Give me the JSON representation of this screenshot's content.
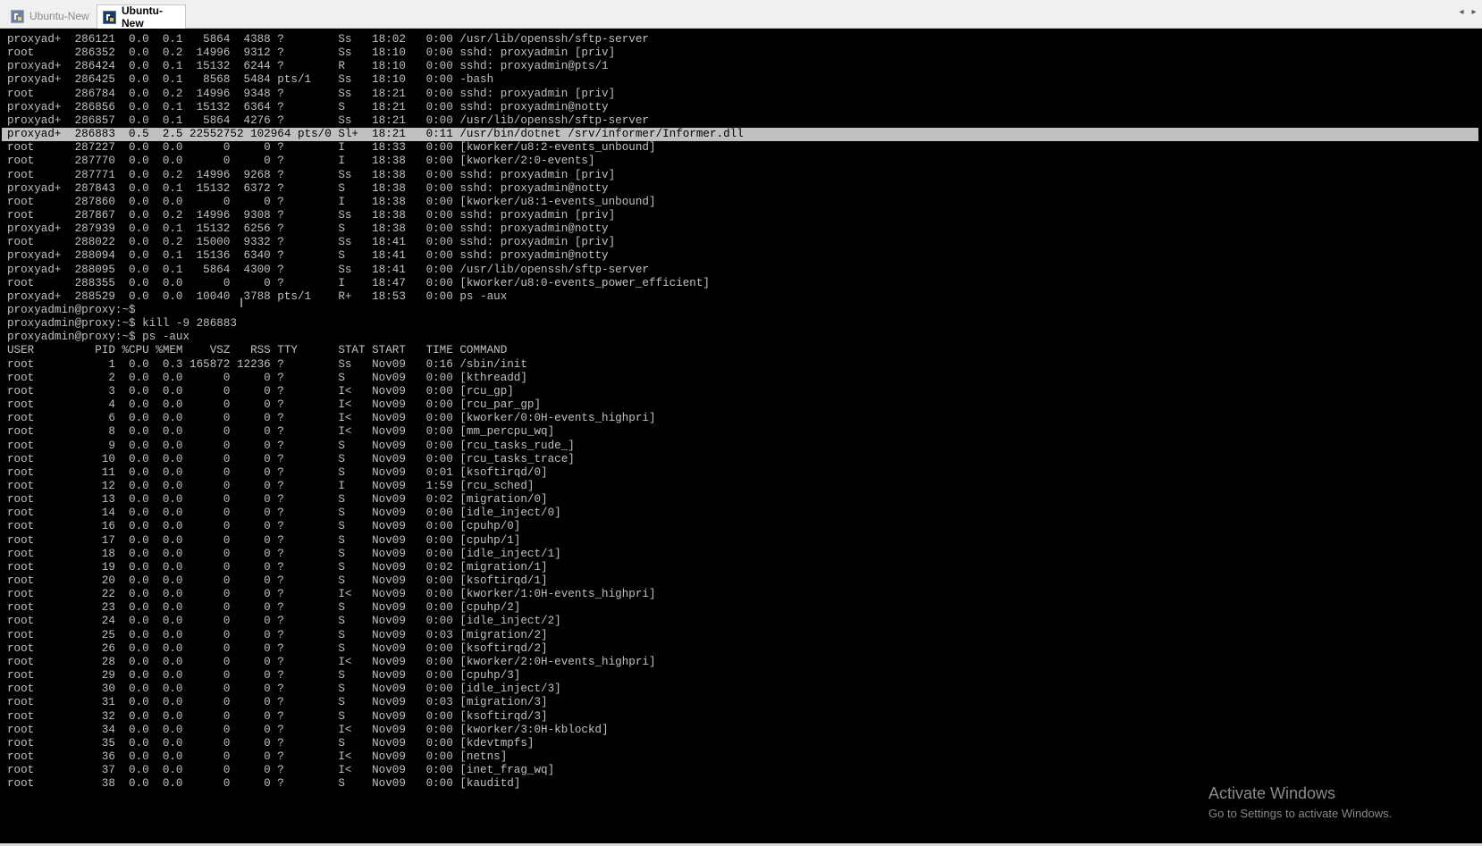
{
  "tabs": [
    {
      "label": "Ubuntu-New",
      "active": false
    },
    {
      "label": "Ubuntu-New",
      "active": true
    }
  ],
  "icons": {
    "tab": "terminal-app-icon",
    "scroll_left": "◂",
    "scroll_right": "▸"
  },
  "colors": {
    "terminal_bg": "#000000",
    "terminal_fg": "#c0c0c0",
    "highlight_bg": "#c0c0c0"
  },
  "terminal": {
    "highlight_index": 7,
    "lines": [
      "proxyad+  286121  0.0  0.1   5864  4388 ?        Ss   18:02   0:00 /usr/lib/openssh/sftp-server",
      "root      286352  0.0  0.2  14996  9312 ?        Ss   18:10   0:00 sshd: proxyadmin [priv]",
      "proxyad+  286424  0.0  0.1  15132  6244 ?        R    18:10   0:00 sshd: proxyadmin@pts/1",
      "proxyad+  286425  0.0  0.1   8568  5484 pts/1    Ss   18:10   0:00 -bash",
      "root      286784  0.0  0.2  14996  9348 ?        Ss   18:21   0:00 sshd: proxyadmin [priv]",
      "proxyad+  286856  0.0  0.1  15132  6364 ?        S    18:21   0:00 sshd: proxyadmin@notty",
      "proxyad+  286857  0.0  0.1   5864  4276 ?        Ss   18:21   0:00 /usr/lib/openssh/sftp-server",
      "proxyad+  286883  0.5  2.5 22552752 102964 pts/0 Sl+  18:21   0:11 /usr/bin/dotnet /srv/informer/Informer.dll",
      "root      287227  0.0  0.0      0     0 ?        I    18:33   0:00 [kworker/u8:2-events_unbound]",
      "root      287770  0.0  0.0      0     0 ?        I    18:38   0:00 [kworker/2:0-events]",
      "root      287771  0.0  0.2  14996  9268 ?        Ss   18:38   0:00 sshd: proxyadmin [priv]",
      "proxyad+  287843  0.0  0.1  15132  6372 ?        S    18:38   0:00 sshd: proxyadmin@notty",
      "root      287860  0.0  0.0      0     0 ?        I    18:38   0:00 [kworker/u8:1-events_unbound]",
      "root      287867  0.0  0.2  14996  9308 ?        Ss   18:38   0:00 sshd: proxyadmin [priv]",
      "proxyad+  287939  0.0  0.1  15132  6256 ?        S    18:38   0:00 sshd: proxyadmin@notty",
      "root      288022  0.0  0.2  15000  9332 ?        Ss   18:41   0:00 sshd: proxyadmin [priv]",
      "proxyad+  288094  0.0  0.1  15136  6340 ?        S    18:41   0:00 sshd: proxyadmin@notty",
      "proxyad+  288095  0.0  0.1   5864  4300 ?        Ss   18:41   0:00 /usr/lib/openssh/sftp-server",
      "root      288355  0.0  0.0      0     0 ?        I    18:47   0:00 [kworker/u8:0-events_power_efficient]",
      "proxyad+  288529  0.0  0.0  10040  3788 pts/1    R+   18:53   0:00 ps -aux",
      "proxyadmin@proxy:~$",
      "proxyadmin@proxy:~$ kill -9 286883",
      "proxyadmin@proxy:~$ ps -aux",
      "USER         PID %CPU %MEM    VSZ   RSS TTY      STAT START   TIME COMMAND",
      "root           1  0.0  0.3 165872 12236 ?        Ss   Nov09   0:16 /sbin/init",
      "root           2  0.0  0.0      0     0 ?        S    Nov09   0:00 [kthreadd]",
      "root           3  0.0  0.0      0     0 ?        I<   Nov09   0:00 [rcu_gp]",
      "root           4  0.0  0.0      0     0 ?        I<   Nov09   0:00 [rcu_par_gp]",
      "root           6  0.0  0.0      0     0 ?        I<   Nov09   0:00 [kworker/0:0H-events_highpri]",
      "root           8  0.0  0.0      0     0 ?        I<   Nov09   0:00 [mm_percpu_wq]",
      "root           9  0.0  0.0      0     0 ?        S    Nov09   0:00 [rcu_tasks_rude_]",
      "root          10  0.0  0.0      0     0 ?        S    Nov09   0:00 [rcu_tasks_trace]",
      "root          11  0.0  0.0      0     0 ?        S    Nov09   0:01 [ksoftirqd/0]",
      "root          12  0.0  0.0      0     0 ?        I    Nov09   1:59 [rcu_sched]",
      "root          13  0.0  0.0      0     0 ?        S    Nov09   0:02 [migration/0]",
      "root          14  0.0  0.0      0     0 ?        S    Nov09   0:00 [idle_inject/0]",
      "root          16  0.0  0.0      0     0 ?        S    Nov09   0:00 [cpuhp/0]",
      "root          17  0.0  0.0      0     0 ?        S    Nov09   0:00 [cpuhp/1]",
      "root          18  0.0  0.0      0     0 ?        S    Nov09   0:00 [idle_inject/1]",
      "root          19  0.0  0.0      0     0 ?        S    Nov09   0:02 [migration/1]",
      "root          20  0.0  0.0      0     0 ?        S    Nov09   0:00 [ksoftirqd/1]",
      "root          22  0.0  0.0      0     0 ?        I<   Nov09   0:00 [kworker/1:0H-events_highpri]",
      "root          23  0.0  0.0      0     0 ?        S    Nov09   0:00 [cpuhp/2]",
      "root          24  0.0  0.0      0     0 ?        S    Nov09   0:00 [idle_inject/2]",
      "root          25  0.0  0.0      0     0 ?        S    Nov09   0:03 [migration/2]",
      "root          26  0.0  0.0      0     0 ?        S    Nov09   0:00 [ksoftirqd/2]",
      "root          28  0.0  0.0      0     0 ?        I<   Nov09   0:00 [kworker/2:0H-events_highpri]",
      "root          29  0.0  0.0      0     0 ?        S    Nov09   0:00 [cpuhp/3]",
      "root          30  0.0  0.0      0     0 ?        S    Nov09   0:00 [idle_inject/3]",
      "root          31  0.0  0.0      0     0 ?        S    Nov09   0:03 [migration/3]",
      "root          32  0.0  0.0      0     0 ?        S    Nov09   0:00 [ksoftirqd/3]",
      "root          34  0.0  0.0      0     0 ?        I<   Nov09   0:00 [kworker/3:0H-kblockd]",
      "root          35  0.0  0.0      0     0 ?        S    Nov09   0:00 [kdevtmpfs]",
      "root          36  0.0  0.0      0     0 ?        I<   Nov09   0:00 [netns]",
      "root          37  0.0  0.0      0     0 ?        I<   Nov09   0:00 [inet_frag_wq]",
      "root          38  0.0  0.0      0     0 ?        S    Nov09   0:00 [kauditd]"
    ]
  },
  "watermark": {
    "title": "Activate Windows",
    "subtitle": "Go to Settings to activate Windows."
  }
}
